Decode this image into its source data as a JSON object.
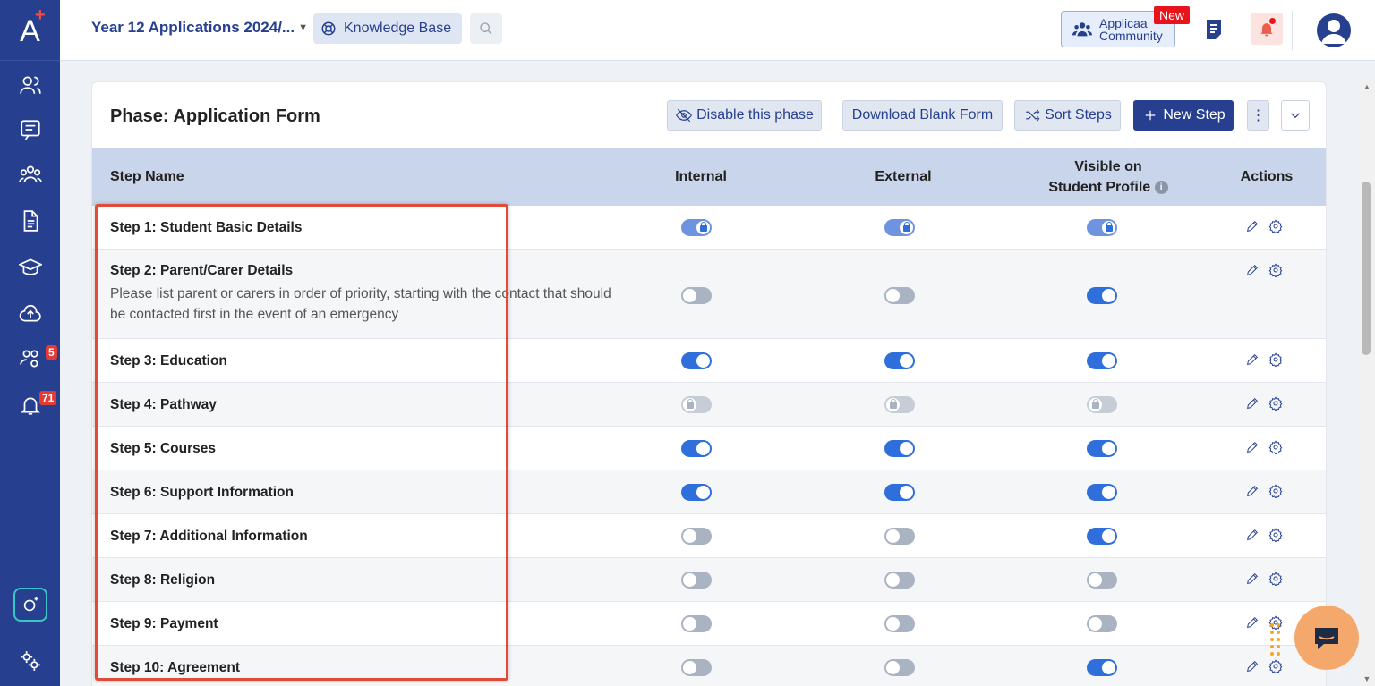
{
  "app": {
    "logo_letter": "A",
    "logo_plus": "+"
  },
  "sidebar": {
    "items": [
      {
        "name": "people-icon"
      },
      {
        "name": "chat-icon"
      },
      {
        "name": "group-icon"
      },
      {
        "name": "document-icon"
      },
      {
        "name": "graduation-cap-icon"
      },
      {
        "name": "cloud-upload-icon"
      },
      {
        "name": "users-settings-icon",
        "badge": "5"
      },
      {
        "name": "bell-icon",
        "badge": "71"
      }
    ],
    "bottom": [
      {
        "name": "instagram-icon"
      },
      {
        "name": "settings-gears-icon"
      }
    ]
  },
  "topbar": {
    "year_select": "Year 12 Applications 2024/...",
    "knowledge_base": "Knowledge Base",
    "community_line1": "Applicaa",
    "community_line2": "Community",
    "new_badge": "New"
  },
  "phase": {
    "title": "Phase: Application Form",
    "disable_label": "Disable this phase",
    "download_label": "Download Blank Form",
    "sort_label": "Sort Steps",
    "new_step_label": "New Step",
    "more_label": "⋮"
  },
  "table": {
    "headers": {
      "step_name": "Step Name",
      "internal": "Internal",
      "external": "External",
      "visible_line1": "Visible on",
      "visible_line2": "Student Profile",
      "actions": "Actions"
    },
    "rows": [
      {
        "name": "Step 1: Student Basic Details",
        "desc": "",
        "internal": "on-locked",
        "external": "on-locked",
        "visible": "on-locked"
      },
      {
        "name": "Step 2: Parent/Carer Details",
        "desc": "Please list parent or carers in order of priority, starting with the contact that should be contacted first in the event of an emergency",
        "internal": "off",
        "external": "off",
        "visible": "on"
      },
      {
        "name": "Step 3: Education",
        "desc": "",
        "internal": "on",
        "external": "on",
        "visible": "on"
      },
      {
        "name": "Step 4: Pathway",
        "desc": "",
        "internal": "disabled-locked",
        "external": "disabled-locked",
        "visible": "disabled-locked"
      },
      {
        "name": "Step 5: Courses",
        "desc": "",
        "internal": "on",
        "external": "on",
        "visible": "on"
      },
      {
        "name": "Step 6: Support Information",
        "desc": "",
        "internal": "on",
        "external": "on",
        "visible": "on"
      },
      {
        "name": "Step 7: Additional Information",
        "desc": "",
        "internal": "off",
        "external": "off",
        "visible": "on"
      },
      {
        "name": "Step 8: Religion",
        "desc": "",
        "internal": "off",
        "external": "off",
        "visible": "off"
      },
      {
        "name": "Step 9: Payment",
        "desc": "",
        "internal": "off",
        "external": "off",
        "visible": "off"
      },
      {
        "name": "Step 10: Agreement",
        "desc": "",
        "internal": "off",
        "external": "off",
        "visible": "on"
      }
    ]
  },
  "colors": {
    "sidebar": "#263f8f",
    "toggle_on": "#2f6fdc",
    "highlight": "#e04b3a",
    "badge": "#e53935"
  }
}
